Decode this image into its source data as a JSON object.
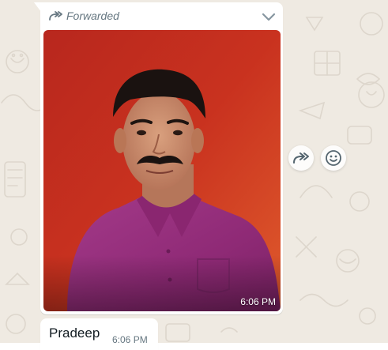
{
  "chat": {
    "background": "#efeae2"
  },
  "image_message": {
    "forwarded_label": "Forwarded",
    "time": "6:06 PM",
    "forwarded_icon": "forward-arrow-icon",
    "menu_icon": "chevron-down-icon",
    "photo_colors": {
      "background_top": "#c22f22",
      "background_bottom": "#d6402a",
      "shirt": "#97307d",
      "skin": "#c98c6c",
      "hair": "#1a1210"
    }
  },
  "side_actions": {
    "forward_icon": "forward-icon",
    "react_icon": "smiley-icon"
  },
  "text_message": {
    "text": "Pradeep",
    "time": "6:06 PM"
  }
}
